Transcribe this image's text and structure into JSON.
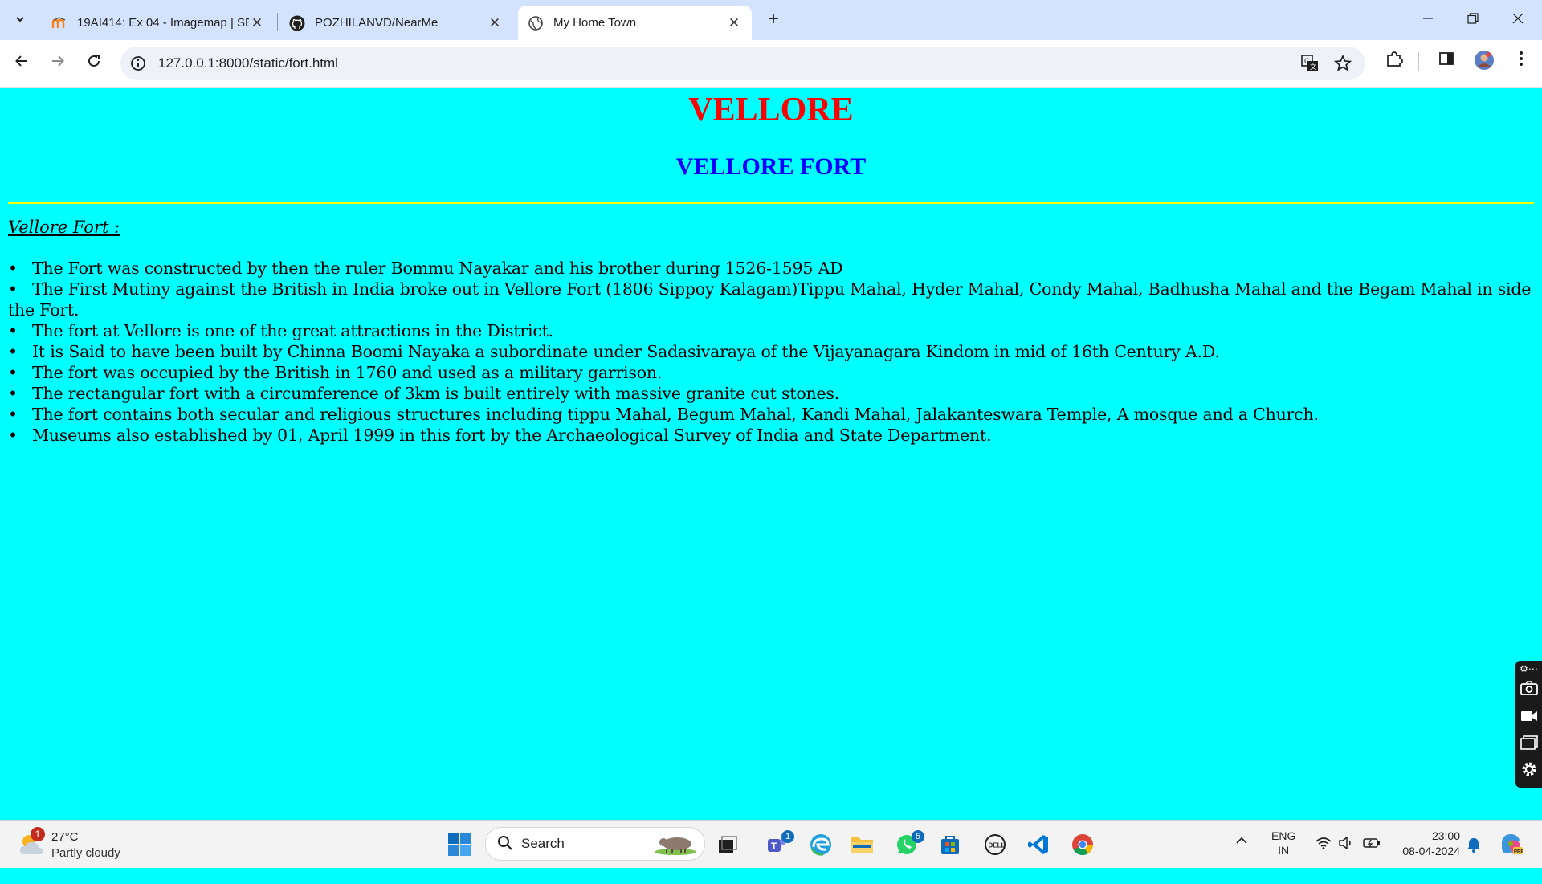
{
  "browser": {
    "tabs": [
      {
        "title": "19AI414: Ex 04 - Imagemap | SE",
        "active": false
      },
      {
        "title": "POZHILANVD/NearMe",
        "active": false
      },
      {
        "title": "My Home Town",
        "active": true
      }
    ],
    "close_glyph": "✕",
    "new_tab_glyph": "+",
    "window_controls": {
      "minimize": "—",
      "restore": "❐",
      "close": "✕"
    },
    "address": "127.0.0.1:8000/static/fort.html"
  },
  "page": {
    "background": "#00ffff",
    "heading": "VELLORE",
    "heading_color": "#ff0000",
    "subheading": "VELLORE FORT",
    "subheading_color": "#0000ff",
    "rule_color": "#ffff00",
    "section_label": "Vellore Fort :",
    "facts": [
      "The Fort was constructed by then the ruler Bommu Nayakar and his brother during 1526-1595 AD",
      "The First Mutiny against the British in India broke out in Vellore Fort (1806 Sippoy Kalagam)Tippu Mahal, Hyder Mahal, Condy Mahal, Badhusha Mahal and the Begam Mahal in side the Fort.",
      "The fort at Vellore is one of the great attractions in the District.",
      "It is Said to have been built by Chinna Boomi Nayaka a subordinate under Sadasivaraya of the Vijayanagara Kindom in mid of 16th Century A.D.",
      "The fort was occupied by the British in 1760 and used as a military garrison.",
      "The rectangular fort with a circumference of 3km is built entirely with massive granite cut stones.",
      "The fort contains both secular and religious structures including tippu Mahal, Begum Mahal, Kandi Mahal, Jalakanteswara Temple, A mosque and a Church.",
      "Museums also established by 01, April 1999 in this fort by the Archaeological Survey of India and State Department."
    ]
  },
  "taskbar": {
    "weather": {
      "badge": "1",
      "temperature": "27°C",
      "condition": "Partly cloudy"
    },
    "search_label": "Search",
    "teams_badge": "1",
    "whatsapp_badge": "5",
    "tray": {
      "language_top": "ENG",
      "language_bottom": "IN",
      "time": "23:00",
      "date": "08-04-2024"
    }
  }
}
